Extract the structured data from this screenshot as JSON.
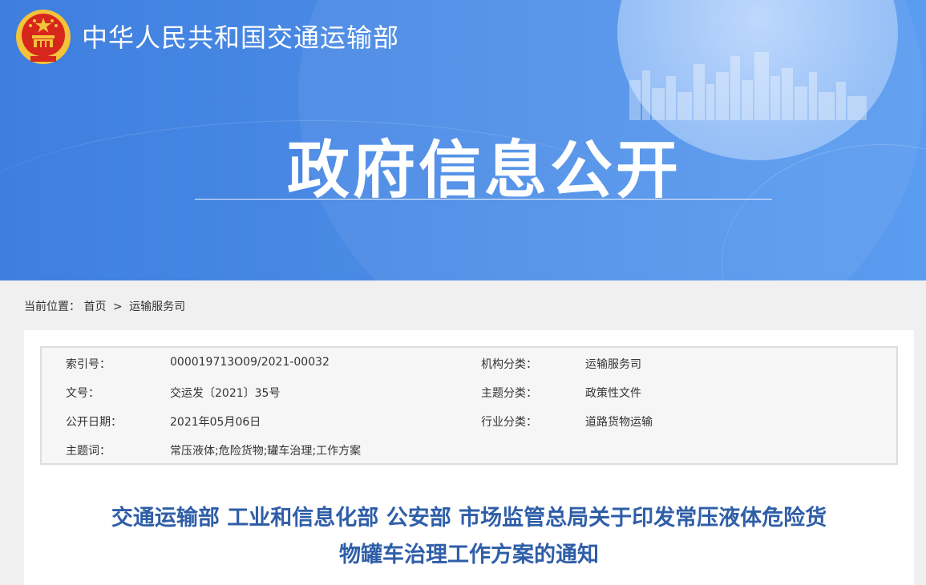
{
  "header": {
    "ministry_name": "中华人民共和国交通运输部",
    "banner_title": "政府信息公开",
    "emblem_icon": "national-emblem-icon"
  },
  "breadcrumb": {
    "prefix": "当前位置：",
    "items": [
      "首页",
      "运输服务司"
    ],
    "separator": ">"
  },
  "meta": {
    "index_label": "索引号：",
    "index_value": "000019713O09/2021-00032",
    "org_label": "机构分类：",
    "org_value": "运输服务司",
    "docno_label": "文号：",
    "docno_value": "交运发〔2021〕35号",
    "topic_label": "主题分类：",
    "topic_value": "政策性文件",
    "date_label": "公开日期：",
    "date_value": "2021年05月06日",
    "industry_label": "行业分类：",
    "industry_value": "道路货物运输",
    "keywords_label": "主题词：",
    "keywords_value": "常压液体;危险货物;罐车治理;工作方案"
  },
  "document": {
    "title_line1": "交通运输部 工业和信息化部 公安部 市场监管总局关于印发常压液体危险货",
    "title_line2": "物罐车治理工作方案的通知"
  },
  "colors": {
    "banner": "#4b8ce6",
    "title": "#2f5ea8",
    "emblem_red": "#d7261c",
    "emblem_gold": "#f3c33a"
  }
}
